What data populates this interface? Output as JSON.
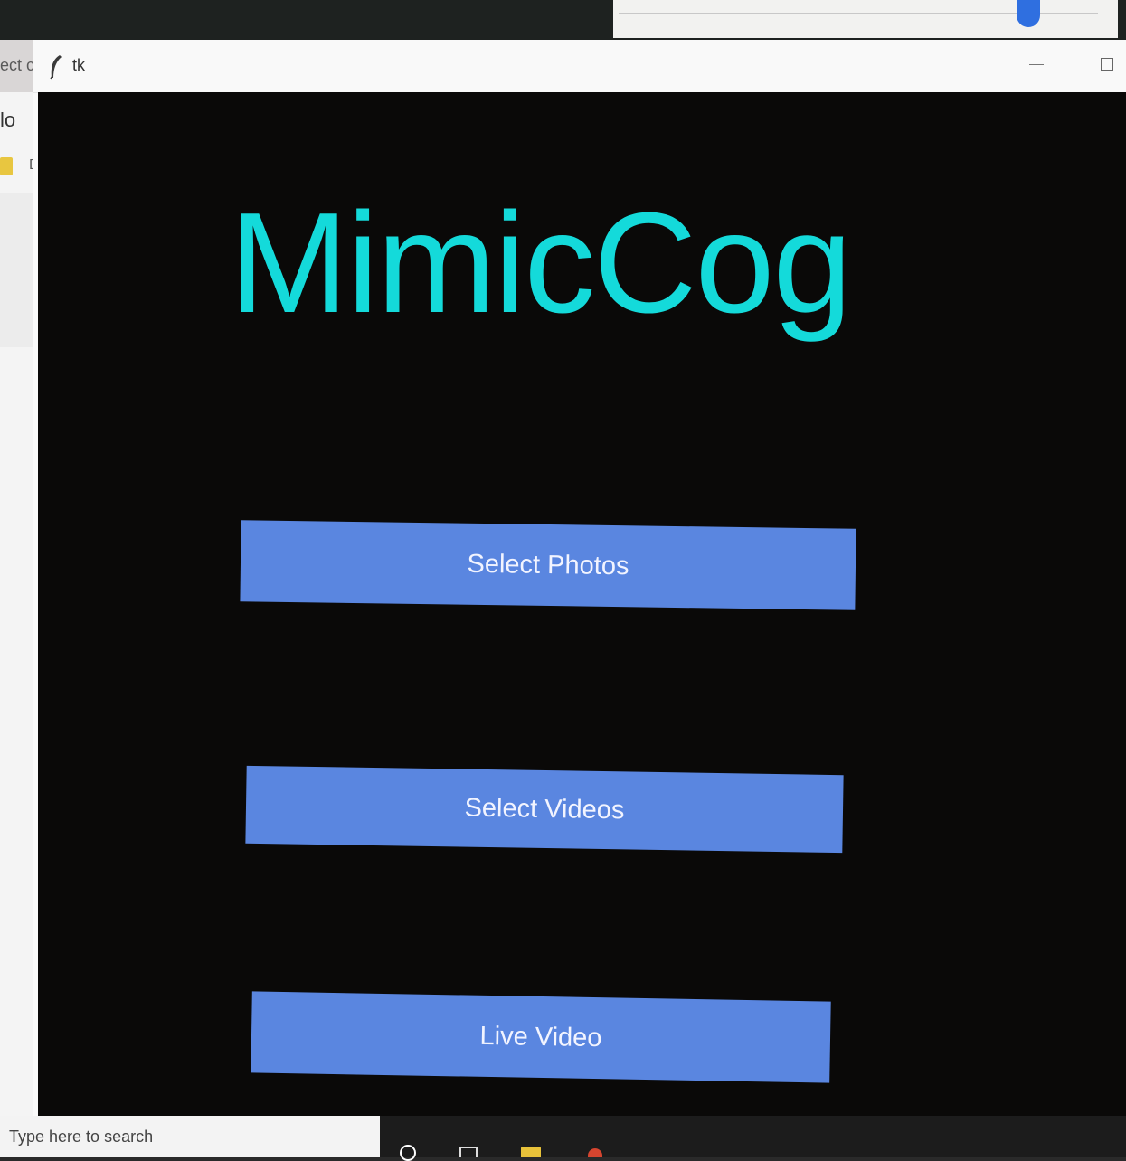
{
  "window": {
    "title": "tk"
  },
  "app": {
    "title": "MimicCog",
    "title_color": "#14dada",
    "button_color": "#5a86e0",
    "buttons": {
      "photos": "Select Photos",
      "videos": "Select Videos",
      "live": "Live Video"
    }
  },
  "background_window": {
    "text_1": "ect c",
    "text_2": "lo",
    "text_3": "D"
  },
  "taskbar": {
    "search_placeholder": "Type here to search"
  },
  "icons": [
    "tk-feather-icon",
    "minimize-icon",
    "maximize-icon",
    "search-icon",
    "task-view-icon",
    "folder-icon",
    "app-icon"
  ]
}
